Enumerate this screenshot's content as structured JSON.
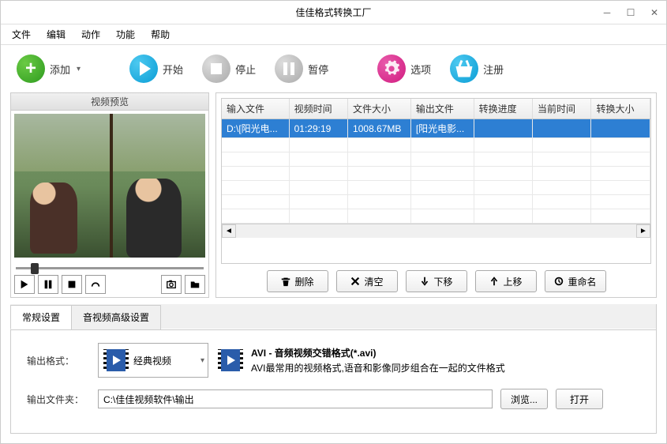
{
  "title": "佳佳格式转换工厂",
  "menu": [
    "文件",
    "编辑",
    "动作",
    "功能",
    "帮助"
  ],
  "toolbar": {
    "add": "添加",
    "start": "开始",
    "stop": "停止",
    "pause": "暂停",
    "options": "选项",
    "register": "注册"
  },
  "preview": {
    "title": "视频预览"
  },
  "table": {
    "headers": [
      "输入文件",
      "视频时间",
      "文件大小",
      "输出文件",
      "转换进度",
      "当前时间",
      "转换大小"
    ],
    "rows": [
      {
        "input": "D:\\[阳光电...",
        "duration": "01:29:19",
        "size": "1008.67MB",
        "output": "[阳光电影...",
        "progress": "",
        "time": "",
        "outsize": ""
      }
    ]
  },
  "listBtns": {
    "delete": "删除",
    "clear": "清空",
    "down": "下移",
    "up": "上移",
    "rename": "重命名"
  },
  "tabs": {
    "general": "常规设置",
    "advanced": "音视频高级设置"
  },
  "settings": {
    "formatLabel": "输出格式：",
    "category": "经典视频",
    "formatTitle": "AVI - 音频视频交错格式(*.avi)",
    "formatDesc": "AVI最常用的视频格式,语音和影像同步组合在一起的文件格式",
    "folderLabel": "输出文件夹：",
    "folderPath": "C:\\佳佳视频软件\\输出",
    "browse": "浏览...",
    "open": "打开"
  }
}
